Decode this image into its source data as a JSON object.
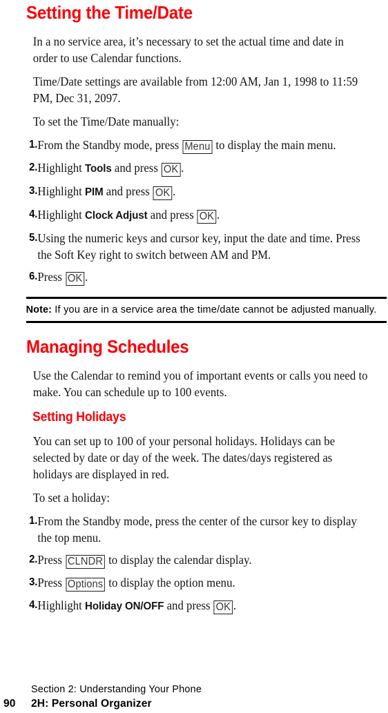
{
  "document": {
    "accent_color": "#fb0007",
    "text_color": "#141414"
  },
  "sections": [
    {
      "heading": "Setting the Time/Date",
      "paragraphs": [
        "In a no service area, it’s necessary to set the actual time and date in order to use Calendar functions.",
        "Time/Date settings are available from 12:00 AM, Jan 1, 1998 to 11:59 PM, Dec 31, 2097.",
        "To set the Time/Date manually:"
      ],
      "steps": [
        {
          "number": "1.",
          "parts": [
            {
              "type": "text",
              "value": "From the Standby mode, press "
            },
            {
              "type": "key",
              "value": "Menu"
            },
            {
              "type": "text",
              "value": " to display the main menu."
            }
          ]
        },
        {
          "number": "2.",
          "parts": [
            {
              "type": "text",
              "value": "Highlight "
            },
            {
              "type": "bold",
              "value": "Tools"
            },
            {
              "type": "text",
              "value": " and press "
            },
            {
              "type": "key",
              "value": "OK"
            },
            {
              "type": "text",
              "value": "."
            }
          ]
        },
        {
          "number": "3.",
          "parts": [
            {
              "type": "text",
              "value": "Highlight "
            },
            {
              "type": "bold",
              "value": "PIM"
            },
            {
              "type": "text",
              "value": " and press "
            },
            {
              "type": "key",
              "value": "OK"
            },
            {
              "type": "text",
              "value": "."
            }
          ]
        },
        {
          "number": "4.",
          "parts": [
            {
              "type": "text",
              "value": "Highlight "
            },
            {
              "type": "bold",
              "value": "Clock Adjust"
            },
            {
              "type": "text",
              "value": " and press "
            },
            {
              "type": "key",
              "value": "OK"
            },
            {
              "type": "text",
              "value": "."
            }
          ]
        },
        {
          "number": "5.",
          "parts": [
            {
              "type": "text",
              "value": "Using the numeric keys and cursor key, input the date and time. Press the Soft Key right to switch between AM and PM."
            }
          ]
        },
        {
          "number": "6.",
          "parts": [
            {
              "type": "text",
              "value": "Press "
            },
            {
              "type": "key",
              "value": "OK"
            },
            {
              "type": "text",
              "value": "."
            }
          ]
        }
      ],
      "note": {
        "label": "Note:",
        "text": " If you are in a service area the time/date cannot be adjusted manually."
      }
    },
    {
      "heading": "Managing Schedules",
      "paragraphs": [
        "Use the Calendar to remind you of important events or calls you need to make. You can schedule up to 100 events."
      ],
      "subheading": "Setting Holidays",
      "sub_paragraphs": [
        "You can set up to 100 of your personal holidays. Holidays can be selected by date or day of the week. The dates/days registered as holidays are displayed in red.",
        "To set a holiday:"
      ],
      "steps": [
        {
          "number": "1.",
          "parts": [
            {
              "type": "text",
              "value": "From the Standby mode, press the center of the cursor key to display the top menu."
            }
          ]
        },
        {
          "number": "2.",
          "parts": [
            {
              "type": "text",
              "value": "Press "
            },
            {
              "type": "key",
              "value": "CLNDR"
            },
            {
              "type": "text",
              "value": " to display the calendar display."
            }
          ]
        },
        {
          "number": "3.",
          "parts": [
            {
              "type": "text",
              "value": "Press "
            },
            {
              "type": "key",
              "value": "Options"
            },
            {
              "type": "text",
              "value": " to display the option menu."
            }
          ]
        },
        {
          "number": "4.",
          "parts": [
            {
              "type": "text",
              "value": "Highlight "
            },
            {
              "type": "bold",
              "value": "Holiday ON/OFF"
            },
            {
              "type": "text",
              "value": " and press "
            },
            {
              "type": "key",
              "value": "OK"
            },
            {
              "type": "text",
              "value": "."
            }
          ]
        }
      ]
    }
  ],
  "footer": {
    "page_number": "90",
    "section_line": "Section 2: Understanding Your Phone",
    "chapter_line": "2H: Personal Organizer"
  }
}
